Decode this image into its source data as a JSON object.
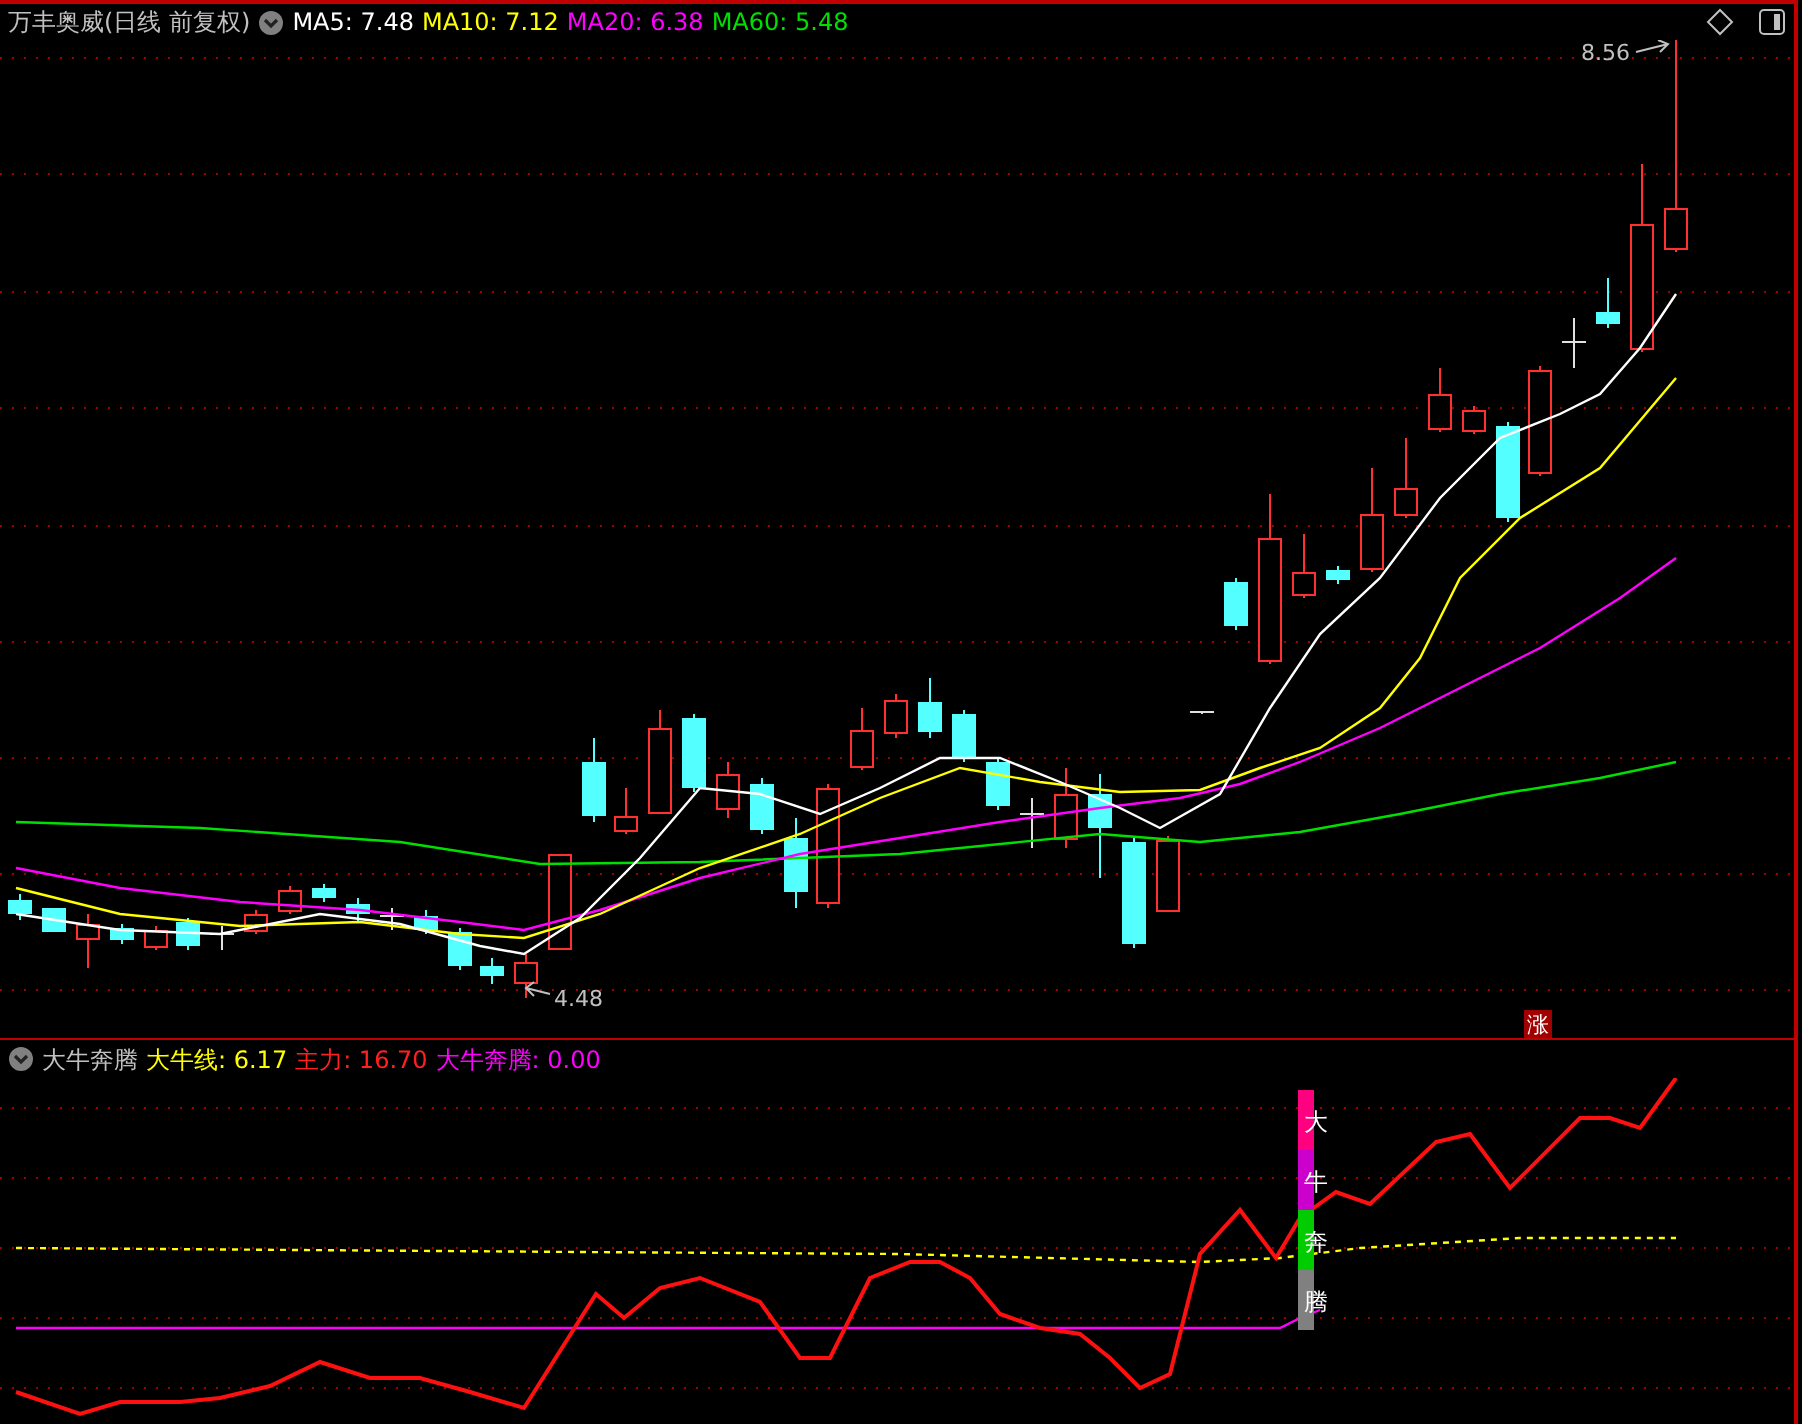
{
  "main_pane": {
    "title": "万丰奥威(日线 前复权)",
    "indicators": [
      {
        "text": "MA5: 7.48",
        "color": "#ffffff"
      },
      {
        "text": "MA10: 7.12",
        "color": "#ffff00"
      },
      {
        "text": "MA20: 6.38",
        "color": "#ff00ff"
      },
      {
        "text": "MA60: 5.48",
        "color": "#00e000"
      }
    ],
    "high_label": "8.56",
    "low_label": "4.48",
    "marker": "涨"
  },
  "sub_pane": {
    "title": "大牛奔腾",
    "indicators": [
      {
        "text": "大牛线: 6.17",
        "color": "#ffff00"
      },
      {
        "text": "主力: 16.70",
        "color": "#ff2020"
      },
      {
        "text": "大牛奔腾: 0.00",
        "color": "#ff00ff"
      }
    ],
    "signal_bar": [
      {
        "text": "大",
        "color": "#ff0080"
      },
      {
        "text": "牛",
        "color": "#cc00cc"
      },
      {
        "text": "奔",
        "color": "#00cc00"
      },
      {
        "text": "腾",
        "color": "#808080"
      }
    ]
  }
}
